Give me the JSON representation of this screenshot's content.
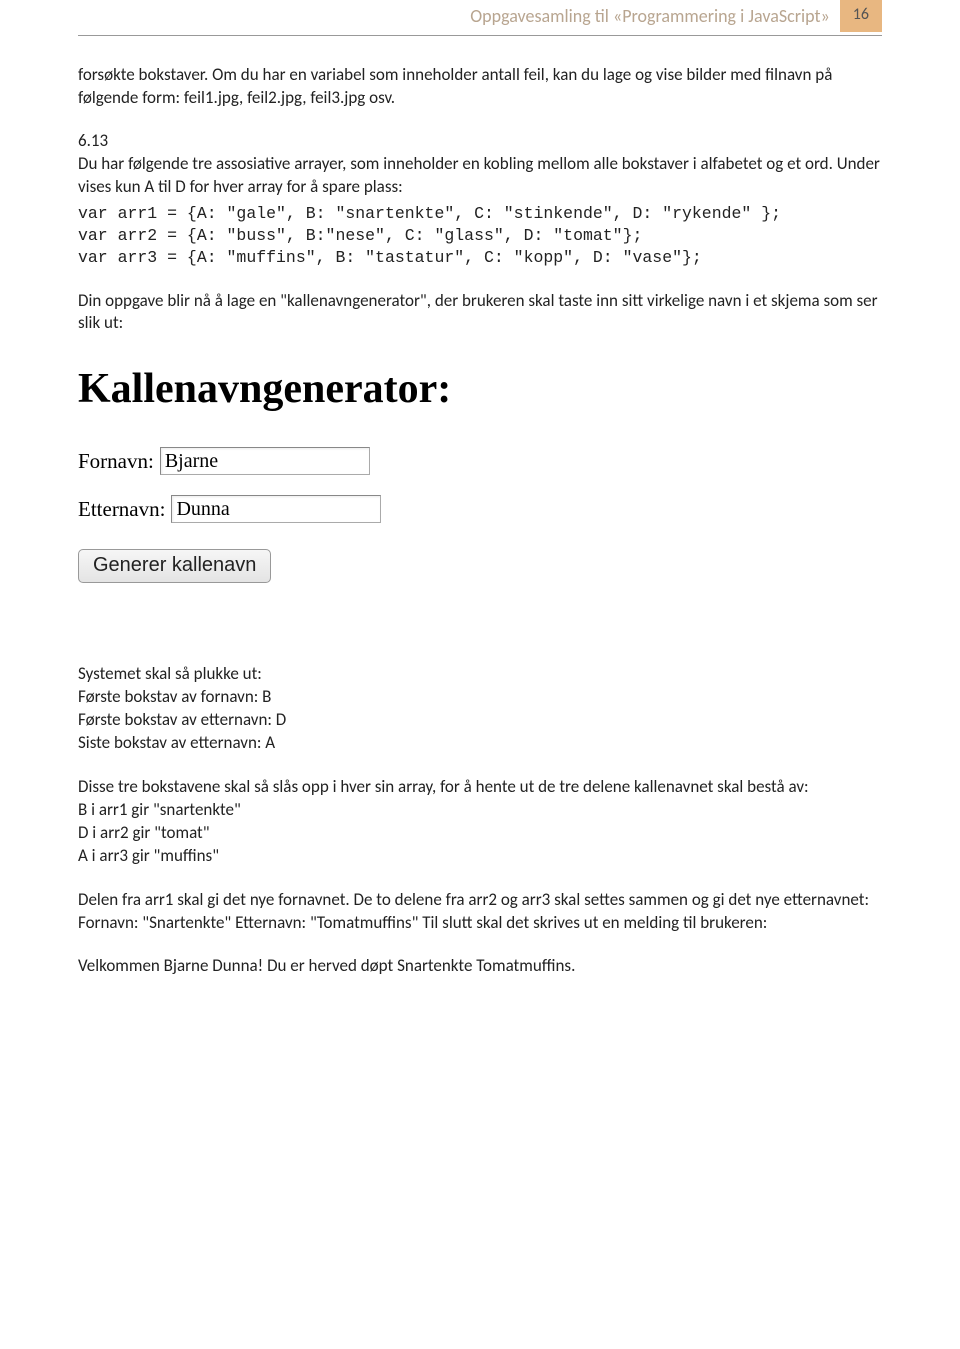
{
  "header": {
    "title": "Oppgavesamling til «Programmering i JavaScript»",
    "page_number": "16"
  },
  "p1": "forsøkte bokstaver. Om du har en variabel som inneholder antall feil, kan du lage og vise bilder med filnavn på følgende form: feil1.jpg, feil2.jpg, feil3.jpg osv.",
  "section_number": "6.13",
  "p2": "Du har følgende tre assosiative arrayer, som inneholder en kobling mellom alle bokstaver i alfabetet og et ord. Under vises kun A til D for hver array for å spare plass:",
  "code": {
    "line1": "var arr1 = {A: \"gale\", B: \"snartenkte\", C: \"stinkende\", D: \"rykende\" };",
    "line2": "var arr2 = {A: \"buss\", B:\"nese\", C: \"glass\", D: \"tomat\"};",
    "line3": "var arr3 = {A: \"muffins\", B: \"tastatur\", C: \"kopp\", D: \"vase\"};"
  },
  "p3": "Din oppgave blir nå å lage en \"kallenavngenerator\", der brukeren skal taste inn sitt virkelige navn i et skjema som ser slik ut:",
  "form": {
    "heading": "Kallenavngenerator:",
    "fornavn_label": "Fornavn:",
    "fornavn_value": "Bjarne",
    "etternavn_label": "Etternavn:",
    "etternavn_value": "Dunna",
    "button_label": "Generer kallenavn"
  },
  "p4_intro": "Systemet skal så plukke ut:",
  "p4_l1": "Første bokstav av fornavn: B",
  "p4_l2": "Første bokstav av etternavn: D",
  "p4_l3": "Siste bokstav av etternavn: A",
  "p5_intro": "Disse tre bokstavene skal så slås opp i hver sin array, for å hente ut de tre delene kallenavnet skal bestå av:",
  "p5_l1": "B i arr1 gir \"snartenkte\"",
  "p5_l2": "D i arr2 gir \"tomat\"",
  "p5_l3": "A i arr3 gir \"muffins\"",
  "p6": "Delen fra arr1 skal gi det nye fornavnet. De to delene fra arr2 og arr3 skal settes sammen og gi det nye etternavnet: Fornavn: \"Snartenkte\" Etternavn: \"Tomatmuffins\" Til slutt skal det skrives ut en melding til brukeren:",
  "p7": "Velkommen Bjarne Dunna! Du er herved døpt Snartenkte Tomatmuffins."
}
